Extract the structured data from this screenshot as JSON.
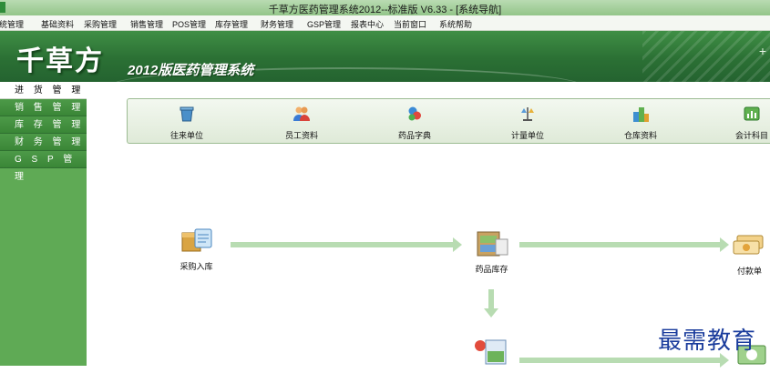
{
  "window": {
    "title": "千草方医药管理系统2012--标准版 V6.33 - [系统导航]"
  },
  "menu": [
    "系统管理",
    "基础资料",
    "采购管理",
    "销售管理",
    "POS管理",
    "库存管理",
    "财务管理",
    "GSP管理",
    "报表中心",
    "当前窗口",
    "系统帮助"
  ],
  "banner": {
    "logo": "千草方",
    "subtitle": "2012版医药管理系统",
    "plus": "+"
  },
  "sidebar": [
    "进 货 管 理",
    "销 售 管 理",
    "库 存 管 理",
    "财 务 管 理",
    "G S P 管 理"
  ],
  "toolbar": [
    "往来单位",
    "员工资料",
    "药品字典",
    "计量单位",
    "仓库资料",
    "会计科目"
  ],
  "flow": {
    "purchase_in": "采购入库",
    "drug_stock": "药品库存",
    "payment": "付款单"
  },
  "watermark": "最需教育",
  "colors": {
    "accent_green": "#3a8637",
    "sidebar_green": "#5faa55",
    "arrow_green": "#b8dcb2"
  }
}
